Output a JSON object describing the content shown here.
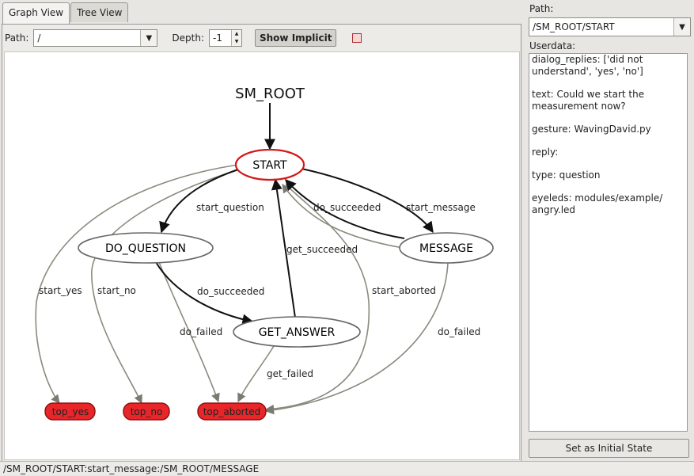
{
  "tabs": [
    {
      "label": "Graph View"
    },
    {
      "label": "Tree View"
    }
  ],
  "toolbar": {
    "path_label": "Path:",
    "path_value": "/",
    "depth_label": "Depth:",
    "depth_value": "-1",
    "show_implicit_label": "Show Implicit"
  },
  "graph": {
    "nodes": {
      "sm_root": "SM_ROOT",
      "start": "START",
      "do_question": "DO_QUESTION",
      "message": "MESSAGE",
      "get_answer": "GET_ANSWER",
      "top_yes": "top_yes",
      "top_no": "top_no",
      "top_aborted": "top_aborted"
    },
    "edges": {
      "start_question": "start_question",
      "do_succeeded_msg": "do_succeeded",
      "start_message": "start_message",
      "start_yes": "start_yes",
      "start_no": "start_no",
      "get_succeeded": "get_succeeded",
      "do_succeeded_q": "do_succeeded",
      "start_aborted": "start_aborted",
      "do_failed_q": "do_failed",
      "do_failed_msg": "do_failed",
      "get_failed": "get_failed"
    },
    "colors": {
      "final_fill": "#e8262a",
      "active_outline": "#d41818",
      "edge": "#111111",
      "implicit_edge": "#8a8a7e"
    }
  },
  "right": {
    "path_label": "Path:",
    "path_value": "/SM_ROOT/START",
    "userdata_label": "Userdata:",
    "userdata": [
      "dialog_replies: ['did not understand', 'yes', 'no']",
      "text: Could we start the measurement now?",
      "gesture: WavingDavid.py",
      "reply:",
      "type: question",
      "eyeleds: modules/example/ angry.led"
    ],
    "set_initial_label": "Set as Initial State"
  },
  "status": "/SM_ROOT/START:start_message:/SM_ROOT/MESSAGE"
}
